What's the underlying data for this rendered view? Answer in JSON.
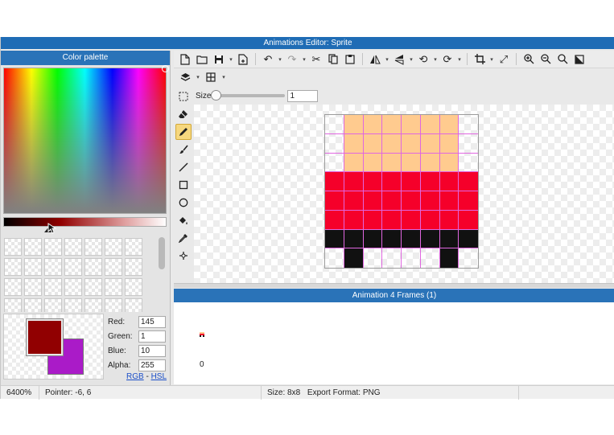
{
  "window": {
    "title": "Animations Editor: Sprite"
  },
  "palette": {
    "title": "Color palette",
    "primary_color": "#910001",
    "secondary_color": "#aa1bc8",
    "fields": [
      {
        "label": "Red:",
        "value": "145"
      },
      {
        "label": "Green:",
        "value": "1"
      },
      {
        "label": "Blue:",
        "value": "10"
      },
      {
        "label": "Alpha:",
        "value": "255"
      }
    ],
    "mode_rgb": "RGB",
    "mode_sep": " - ",
    "mode_hsl": "HSL"
  },
  "toolbar": {
    "size_label": "Size",
    "size_value": "1",
    "size_fraction": 0.0
  },
  "sprite": {
    "rows": [
      [
        "#ffffff00",
        "#ffcb8f",
        "#ffcb8f",
        "#ffcb8f",
        "#ffcb8f",
        "#ffcb8f",
        "#ffcb8f",
        "#ffffff00"
      ],
      [
        "#ffffff00",
        "#ffcb8f",
        "#ffcb8f",
        "#ffcb8f",
        "#ffcb8f",
        "#ffcb8f",
        "#ffcb8f",
        "#ffffff00"
      ],
      [
        "#ffffff00",
        "#ffcb8f",
        "#ffcb8f",
        "#ffcb8f",
        "#ffcb8f",
        "#ffcb8f",
        "#ffcb8f",
        "#ffffff00"
      ],
      [
        "#f5002a",
        "#f5002a",
        "#f5002a",
        "#f5002a",
        "#f5002a",
        "#f5002a",
        "#f5002a",
        "#f5002a"
      ],
      [
        "#f5002a",
        "#f5002a",
        "#f5002a",
        "#f5002a",
        "#f5002a",
        "#f5002a",
        "#f5002a",
        "#f5002a"
      ],
      [
        "#f5002a",
        "#f5002a",
        "#f5002a",
        "#f5002a",
        "#f5002a",
        "#f5002a",
        "#f5002a",
        "#f5002a"
      ],
      [
        "#111111",
        "#111111",
        "#111111",
        "#111111",
        "#111111",
        "#111111",
        "#111111",
        "#111111"
      ],
      [
        "#ffffff00",
        "#111111",
        "#ffffff00",
        "#ffffff00",
        "#ffffff00",
        "#ffffff00",
        "#111111",
        "#ffffff00"
      ]
    ]
  },
  "animation": {
    "title": "Animation 4 Frames (1)",
    "frame_label": "0"
  },
  "status": {
    "zoom": "6400%",
    "pointer": "Pointer: -6, 6",
    "size": "Size: 8x8",
    "format": "Export Format: PNG"
  }
}
